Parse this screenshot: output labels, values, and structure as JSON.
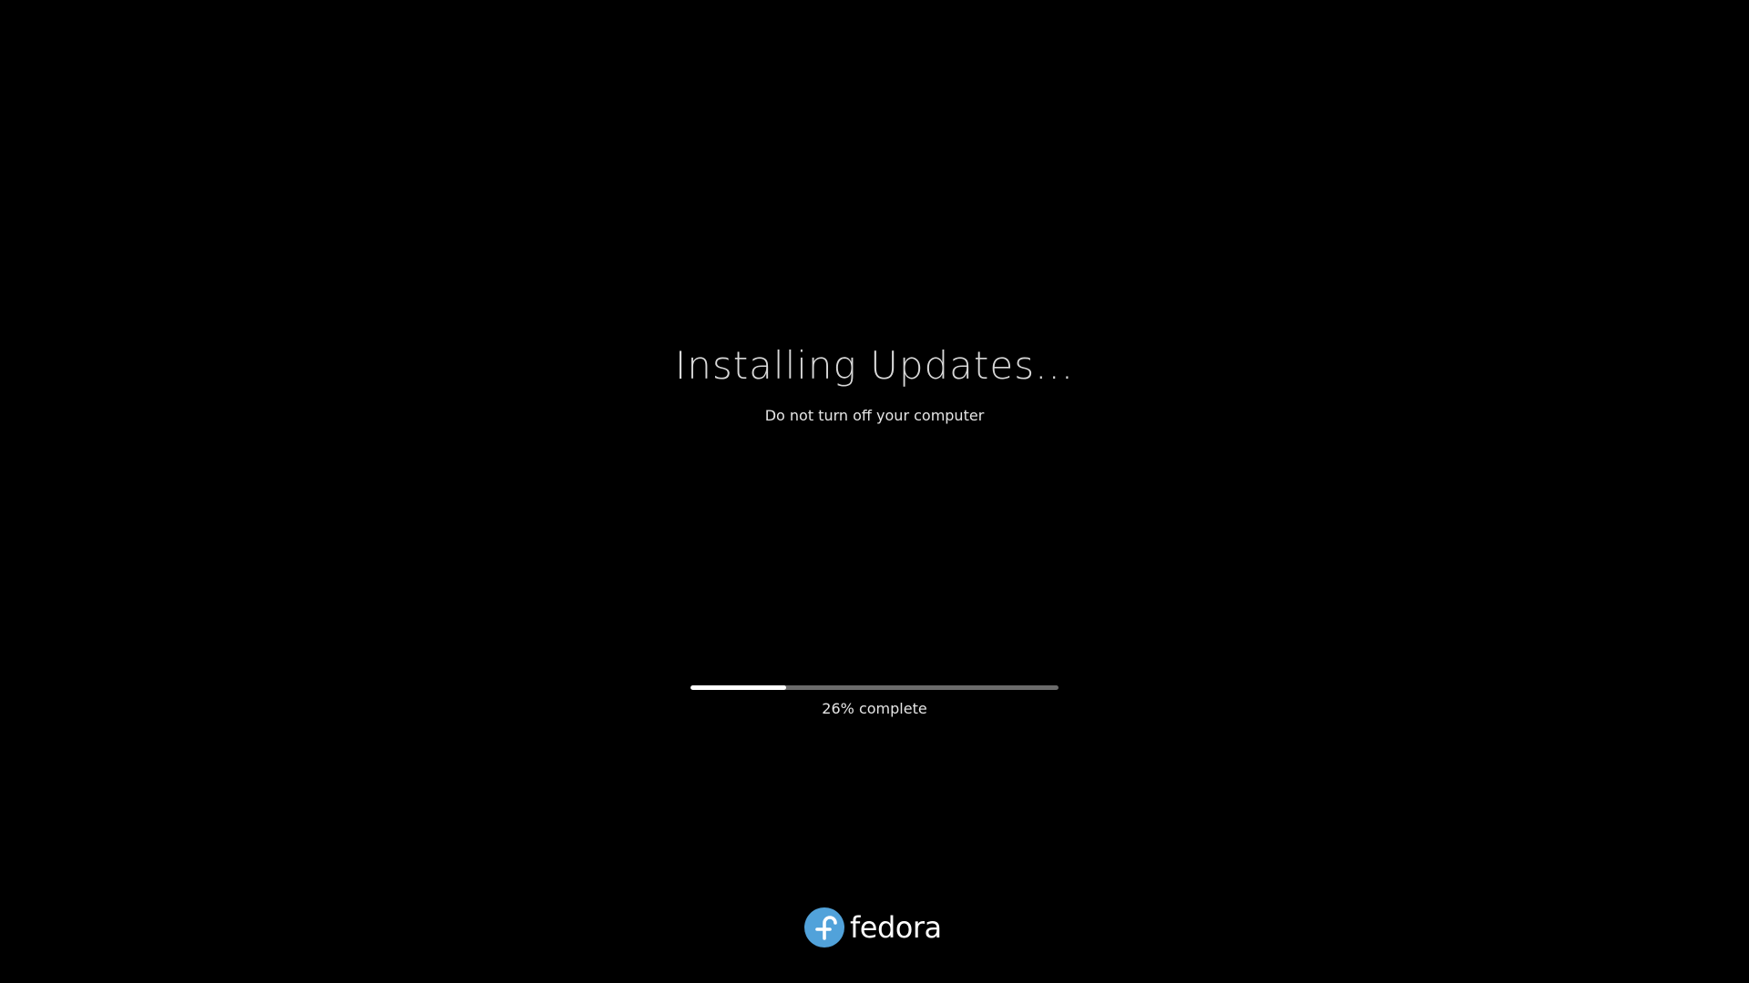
{
  "screen": {
    "title": "Installing Updates...",
    "subtitle": "Do not turn off your computer",
    "progress": {
      "percent": 26,
      "label": "26% complete"
    }
  },
  "brand": {
    "wordmark": "fedora",
    "logo_icon": "fedora-infinity-icon",
    "accent_color": "#51a2da"
  },
  "colors": {
    "background": "#000000",
    "progress_track": "#6b6b6b",
    "progress_fill": "#ffffff"
  }
}
